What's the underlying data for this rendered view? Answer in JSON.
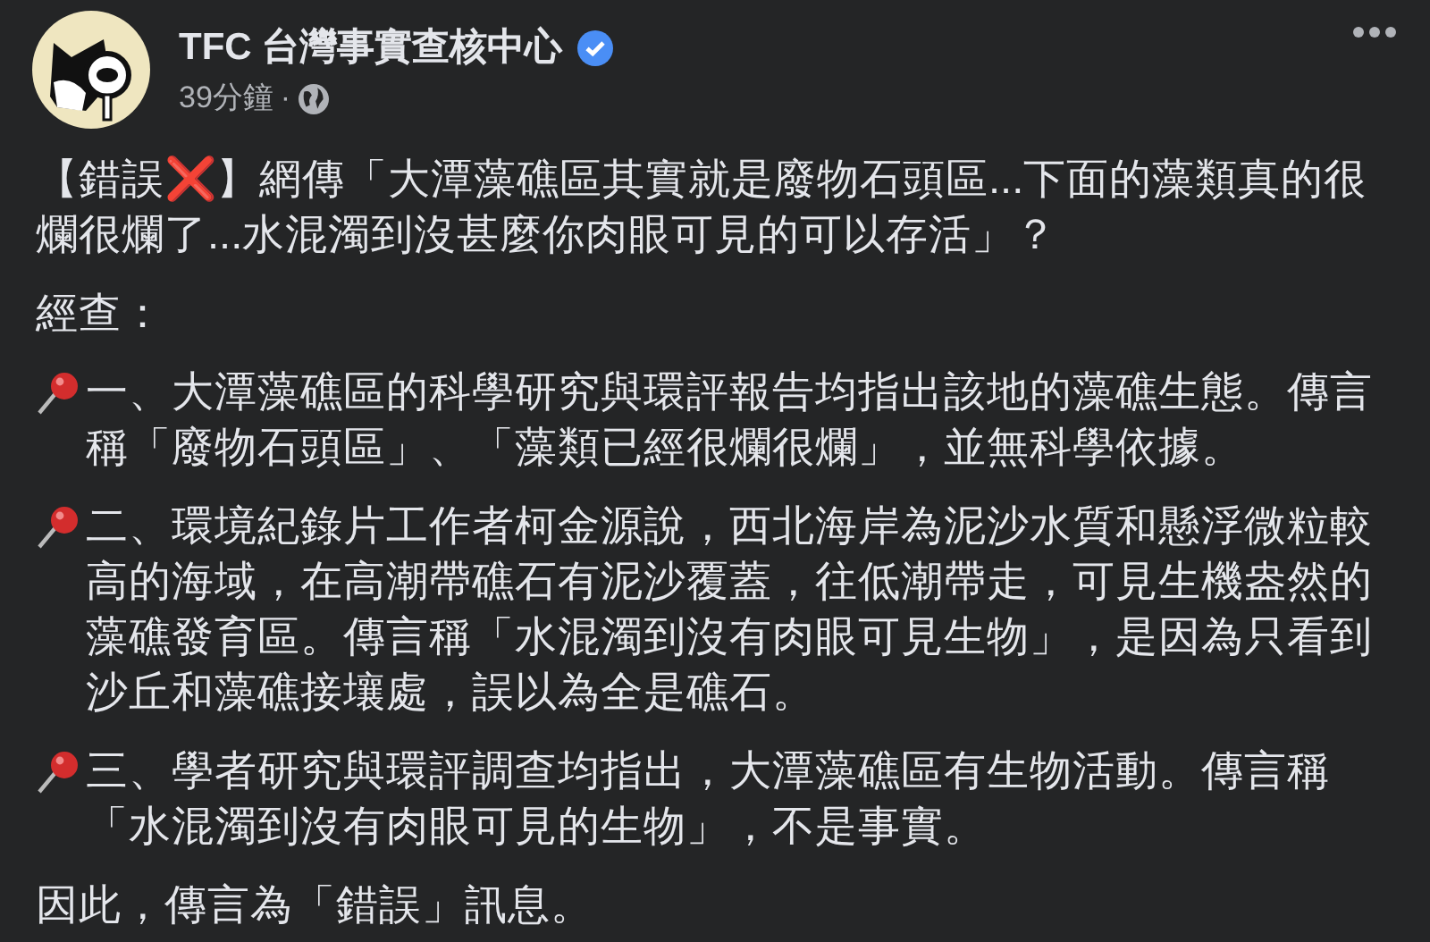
{
  "post": {
    "author": "TFC 台灣事實查核中心",
    "verified": true,
    "time": "39分鐘",
    "separator": "·",
    "paragraphs": [
      {
        "kind": "text",
        "text": "【錯誤❌】網傳「大潭藻礁區其實就是廢物石頭區...下面的藻類真的很爛很爛了...水混濁到沒甚麼你肉眼可見的可以存活」？"
      },
      {
        "kind": "text",
        "text": "經查："
      },
      {
        "kind": "pinned",
        "text": "一、大潭藻礁區的科學研究與環評報告均指出該地的藻礁生態。傳言稱「廢物石頭區」、「藻類已經很爛很爛」，並無科學依據。"
      },
      {
        "kind": "pinned",
        "text": "二、環境紀錄片工作者柯金源說，西北海岸為泥沙水質和懸浮微粒較高的海域，在高潮帶礁石有泥沙覆蓋，往低潮帶走，可見生機盎然的藻礁發育區。傳言稱「水混濁到沒有肉眼可見生物」，是因為只看到沙丘和藻礁接壤處，誤以為全是礁石。"
      },
      {
        "kind": "pinned",
        "text": "三、學者研究與環評調查均指出，大潭藻礁區有生物活動。傳言稱「水混濁到沒有肉眼可見的生物」，不是事實。"
      },
      {
        "kind": "text",
        "text": "因此，傳言為「錯誤」訊息。"
      }
    ]
  }
}
